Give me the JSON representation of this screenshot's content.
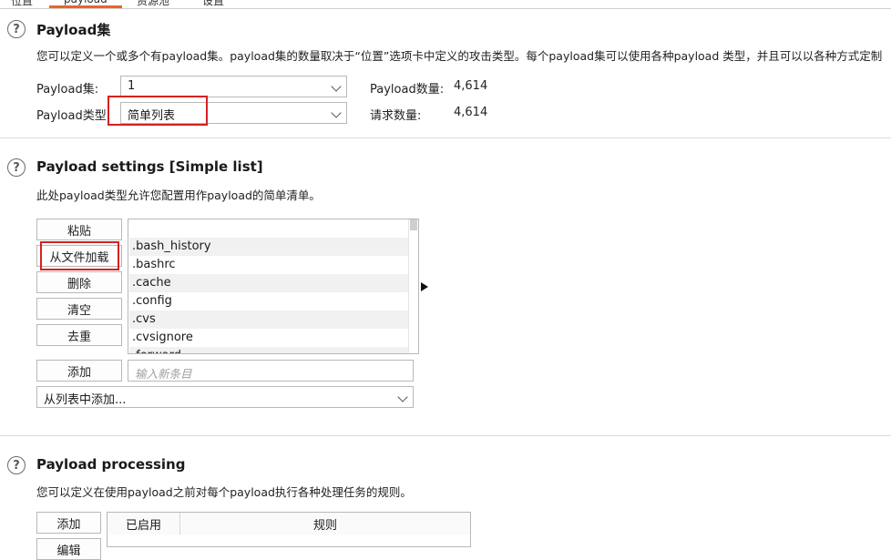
{
  "tabs": [
    {
      "label": "位置"
    },
    {
      "label": "payload"
    },
    {
      "label": "资源池"
    },
    {
      "label": "设置"
    }
  ],
  "payload_sets": {
    "title": "Payload集",
    "description": "您可以定义一个或多个有payload集。payload集的数量取决于“位置”选项卡中定义的攻击类型。每个payload集可以使用各种payload 类型，并且可以以各种方式定制",
    "set_label": "Payload集:",
    "set_value": "1",
    "type_label": "Payload类型:",
    "type_value": "简单列表",
    "count_label": "Payload数量:",
    "count_value": "4,614",
    "requests_label": "请求数量:",
    "requests_value": "4,614"
  },
  "payload_settings": {
    "title": "Payload settings [Simple list]",
    "description": "此处payload类型允许您配置用作payload的简单清单。",
    "buttons": {
      "paste": "粘贴",
      "load": "从文件加载",
      "remove": "删除",
      "clear": "清空",
      "dedupe": "去重",
      "add": "添加"
    },
    "items": [
      ".bash_history",
      ".bashrc",
      ".cache",
      ".config",
      ".cvs",
      ".cvsignore",
      ".forward"
    ],
    "add_placeholder": "输入新条目",
    "add_from_list": "从列表中添加..."
  },
  "payload_processing": {
    "title": "Payload processing",
    "description": "您可以定义在使用payload之前对每个payload执行各种处理任务的规则。",
    "buttons": {
      "add": "添加",
      "edit": "编辑"
    },
    "columns": [
      "已启用",
      "规则"
    ]
  },
  "colors": {
    "highlight": "#d62020",
    "active_tab": "#e8662a"
  }
}
